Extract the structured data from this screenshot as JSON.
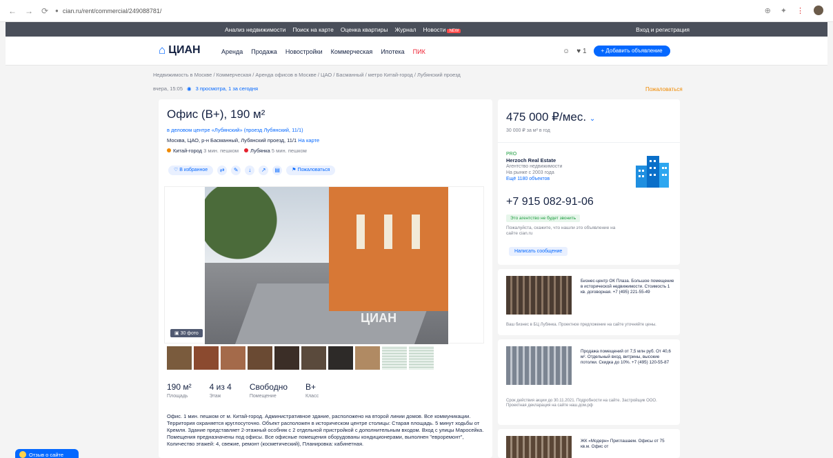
{
  "browser": {
    "address": "cian.ru/rent/commercial/249088781/",
    "icons": [
      "back-icon",
      "forward-icon",
      "reload-icon",
      "lock-icon",
      "zoom-icon",
      "extension-icon",
      "menu-icon",
      "profile-avatar"
    ]
  },
  "topbar": {
    "links": [
      "Анализ недвижимости",
      "Поиск на карте",
      "Оценка квартиры",
      "Журнал",
      "Новости"
    ],
    "badge": "NEW",
    "login": "Вход и регистрация"
  },
  "nav": {
    "logo": "ЦИАН",
    "menu": [
      "Аренда",
      "Продажа",
      "Новостройки",
      "Коммерческая",
      "Ипотека",
      "ПИК"
    ],
    "fav_count": "1",
    "add_button": "+ Добавить объявление"
  },
  "breadcrumbs": "Недвижимость в Москве / Коммерческая / Аренда офисов в Москве / ЦАО / Басманный / метро Китай-город / Лубянский проезд",
  "meta": {
    "updated": "вчера, 15:05",
    "views": "3 просмотра, 1 за сегодня",
    "complain": "Пожаловаться"
  },
  "listing": {
    "title": "Офис (B+), 190 м²",
    "business_center": "в деловом центре «Лубянский» (проезд Лубянский, 11/1)",
    "address": "Москва, ЦАО, р-н Басманный, Лубянский проезд, 11/1",
    "map_link": "На карте",
    "metro": [
      {
        "name": "Китай-город",
        "time": "3 мин. пешком",
        "color": "#f08a00"
      },
      {
        "name": "Лубянка",
        "time": "5 мин. пешком",
        "color": "#e4222e"
      }
    ],
    "actions": {
      "favorite": "В избранное",
      "more": "Пожаловаться"
    },
    "photo_count": "30 фото",
    "watermark": "ЦИАН",
    "specs": [
      {
        "value": "190 м²",
        "label": "Площадь"
      },
      {
        "value": "4 из 4",
        "label": "Этаж"
      },
      {
        "value": "Свободно",
        "label": "Помещение"
      },
      {
        "value": "B+",
        "label": "Класс"
      }
    ],
    "description": "Офис. 1 мин. пешком от м. Китай-город. Административное здание, расположено на второй линии домов. Все коммуникации. Территория охраняется круглосуточно. Объект расположен в историческом центре столицы: Старая площадь. 5 минут ходьбы от Кремля. Здание представляет 2-этажный особняк с 2 отдельной пристройкой с дополнительным входом. Вход с улицы Маросейка. Помещения предназначены под офисы. Все офисные помещения оборудованы кондиционерами, выполнен \"евроремонт\", Количество этажей: 4, свежие, ремонт (косметический), Планировка: кабинетная."
  },
  "price_card": {
    "price": "475 000 ₽/мес.",
    "price_sub": "30 000 ₽ за м² в год",
    "pro": "PRO",
    "agency": "Herzoch Real Estate",
    "agency_type": "Агентство недвижимости",
    "agency_since": "На рынке с 2003 года",
    "agency_objects": "Ещё 1180 объектов",
    "phone": "+7 915 082-91-06",
    "hint": "Это агентство не будет звонить",
    "hint2": "Пожалуйста, скажите, что нашли это объявление на сайте cian.ru",
    "message_button": "Написать сообщение"
  },
  "ads": [
    {
      "text": "Бизнес-центр ОК Плаза. Большое помещение в исторической недвижимости. Стоимость 1 кв. договорная. +7 (495) 221-55-49",
      "foot": "Ваш бизнес в БЦ Лубянка. Проектное предложение на сайте уточняйте цены."
    },
    {
      "text": "Продажа помещений от 7,5 млн руб. От 40,6 м². Отдельный вход, витрины, высокие потолки. Скидка до 10%. +7 (495) 120-55-87",
      "foot": "Срок действия акции до 30.11.2021. Подробности на сайте. Застройщик ООО. Проектная декларация на сайте наш.дом.рф"
    },
    {
      "text": "ЖК «Модерн» Приглашаем. Офисы от 75 кв.м. Офис от"
    }
  ],
  "chat_button": "Отзыв о сайте",
  "colors": {
    "accent": "#0468ff",
    "text": "#152242",
    "topbar": "#4a4f5a",
    "warning": "#f08a00",
    "pro": "#1a9c3c"
  }
}
